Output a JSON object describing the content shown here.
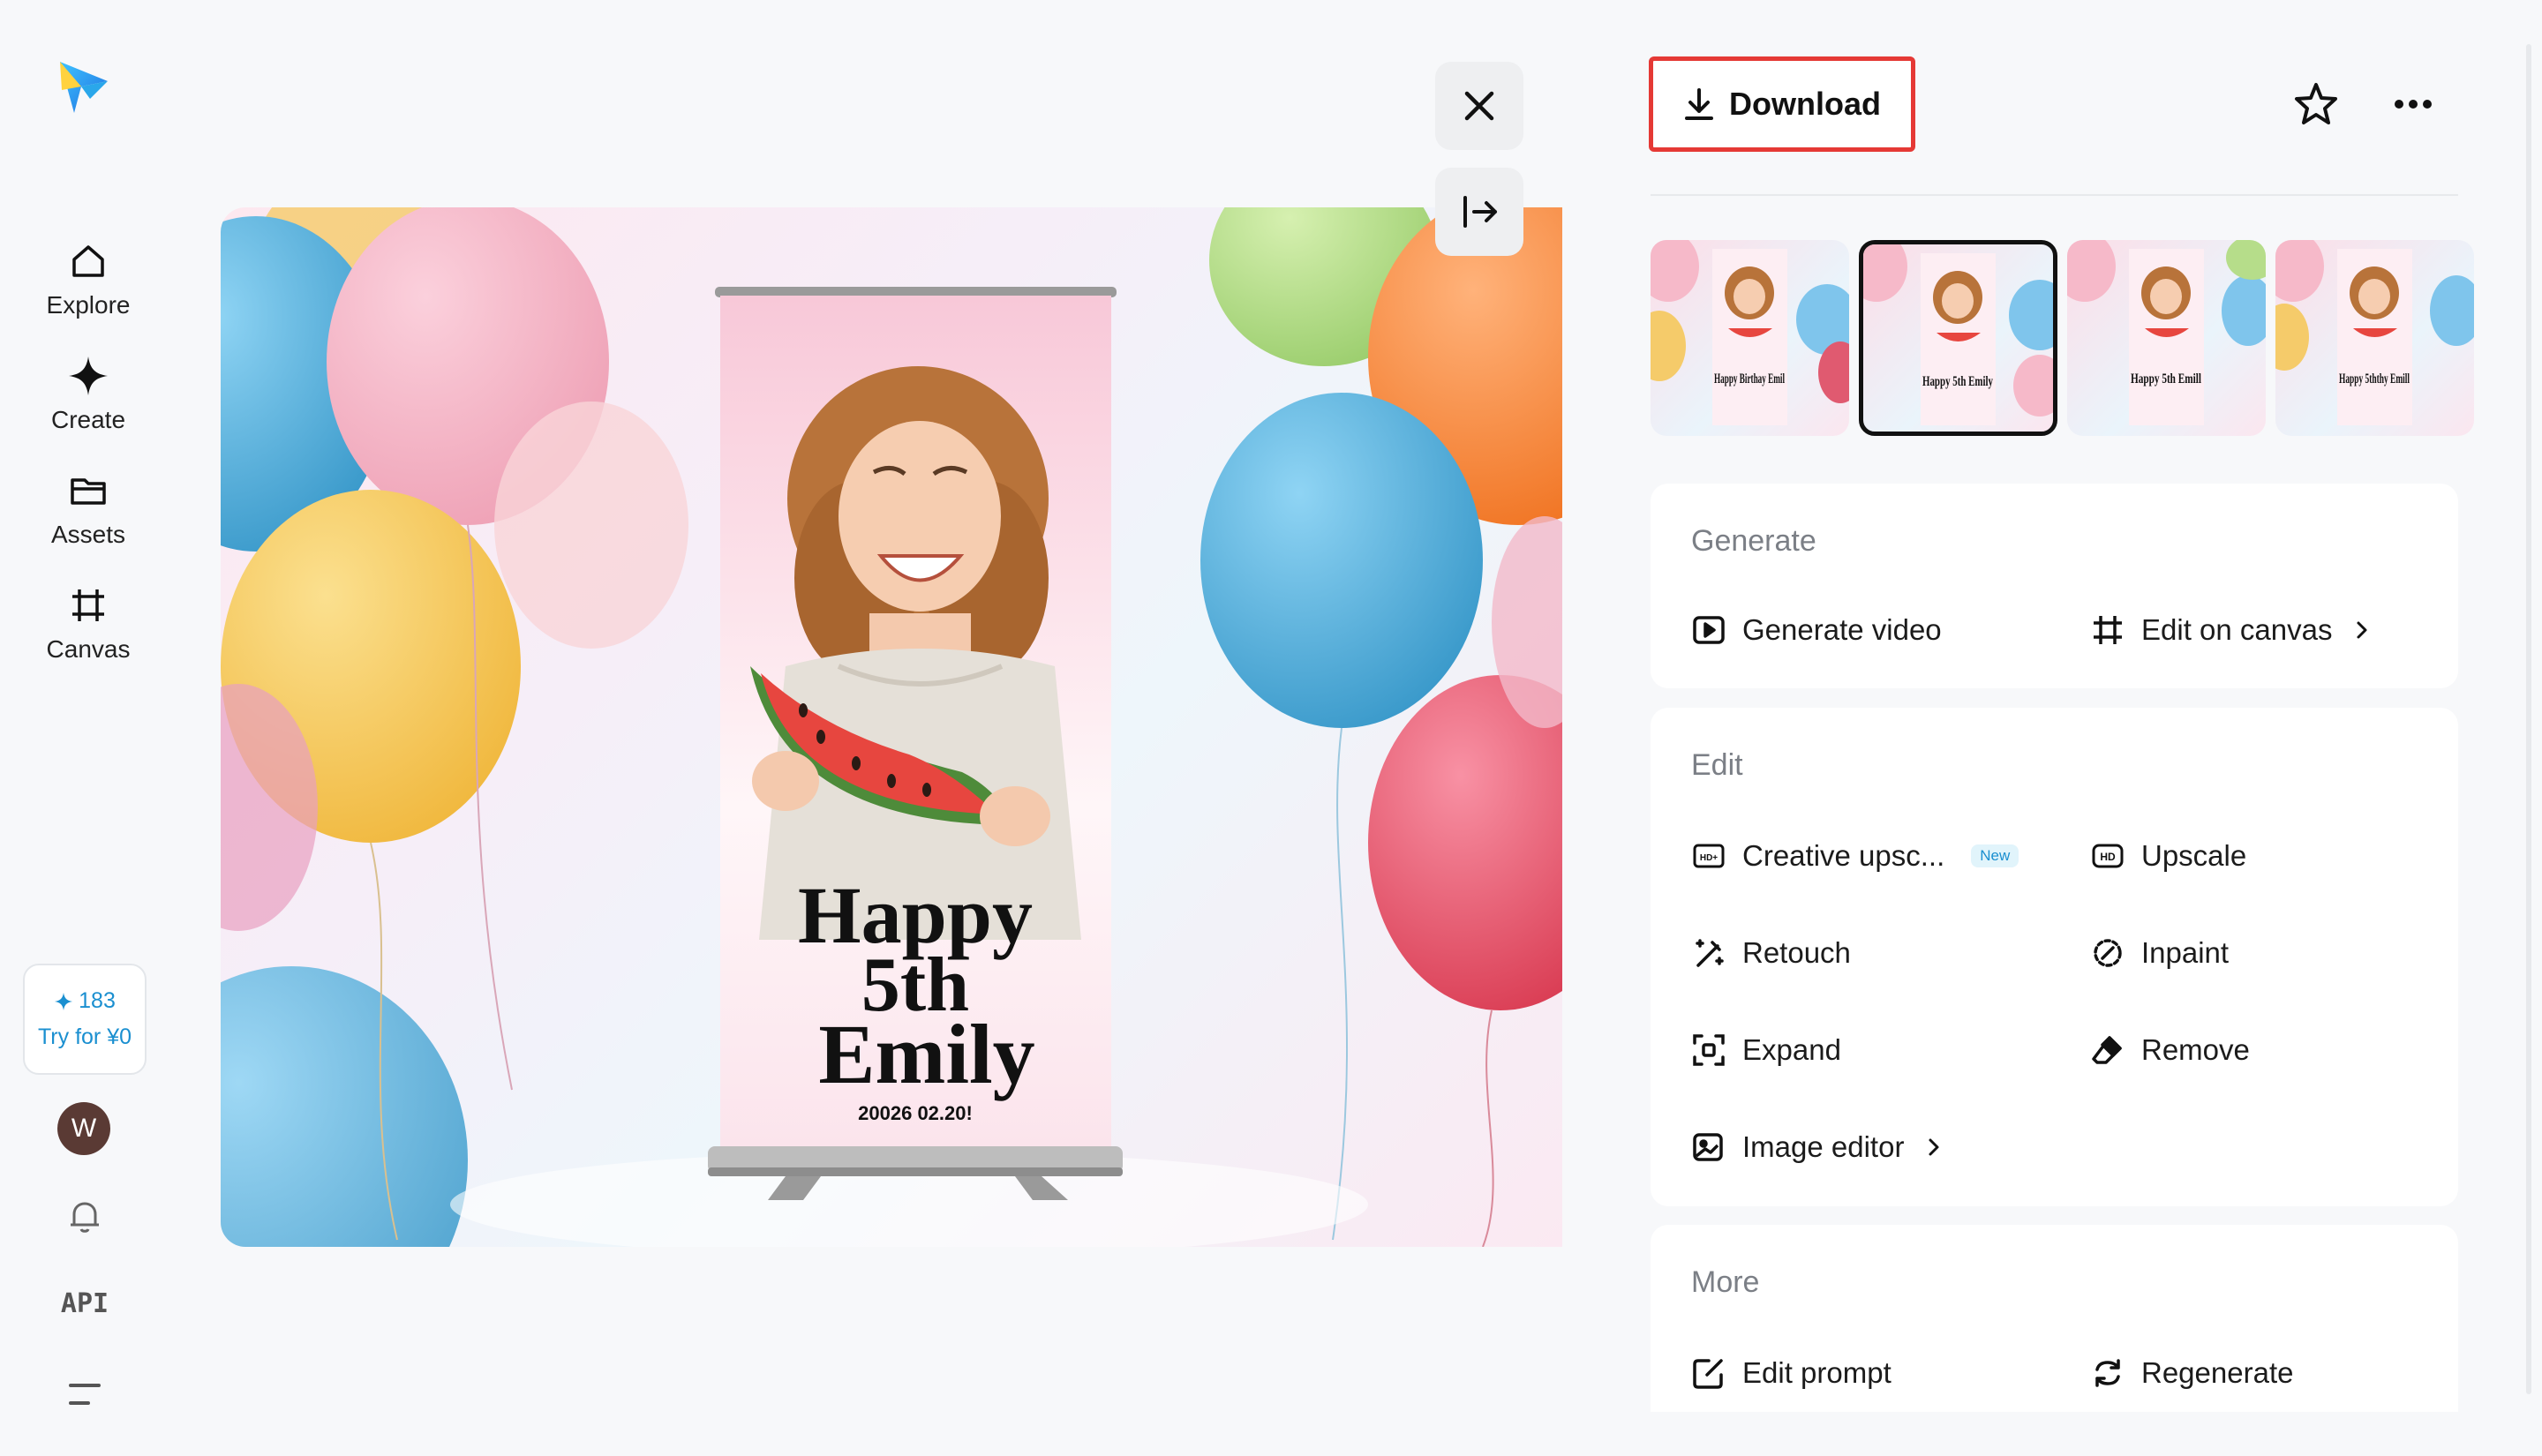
{
  "sidebar": {
    "nav": [
      {
        "label": "Explore",
        "icon": "home-icon"
      },
      {
        "label": "Create",
        "icon": "sparkle-icon"
      },
      {
        "label": "Assets",
        "icon": "folder-icon"
      },
      {
        "label": "Canvas",
        "icon": "crop-icon"
      }
    ],
    "credits": "183",
    "trial": "Try for ¥0",
    "avatar_letter": "W",
    "api_label": "API"
  },
  "poster": {
    "line1": "Happy",
    "line2": "5th",
    "line3": "Emily",
    "date": "20026 02.20!"
  },
  "toolbar": {
    "download_label": "Download"
  },
  "thumbnails": [
    {
      "text": "Happy Birthay Emil",
      "selected": false
    },
    {
      "text": "Happy 5th Emily",
      "selected": true
    },
    {
      "text": "Happy 5th Emill",
      "selected": false
    },
    {
      "text": "Happy 5ththy Emill",
      "selected": false
    }
  ],
  "generate": {
    "title": "Generate",
    "generate_video": "Generate video",
    "edit_on_canvas": "Edit on canvas"
  },
  "edit": {
    "title": "Edit",
    "creative_upscale": "Creative upsc...",
    "new_badge": "New",
    "upscale": "Upscale",
    "retouch": "Retouch",
    "inpaint": "Inpaint",
    "expand": "Expand",
    "remove": "Remove",
    "image_editor": "Image editor"
  },
  "more": {
    "title": "More",
    "edit_prompt": "Edit prompt",
    "regenerate": "Regenerate"
  },
  "colors": {
    "accent": "#1a8fd0",
    "highlight": "#e53935"
  }
}
